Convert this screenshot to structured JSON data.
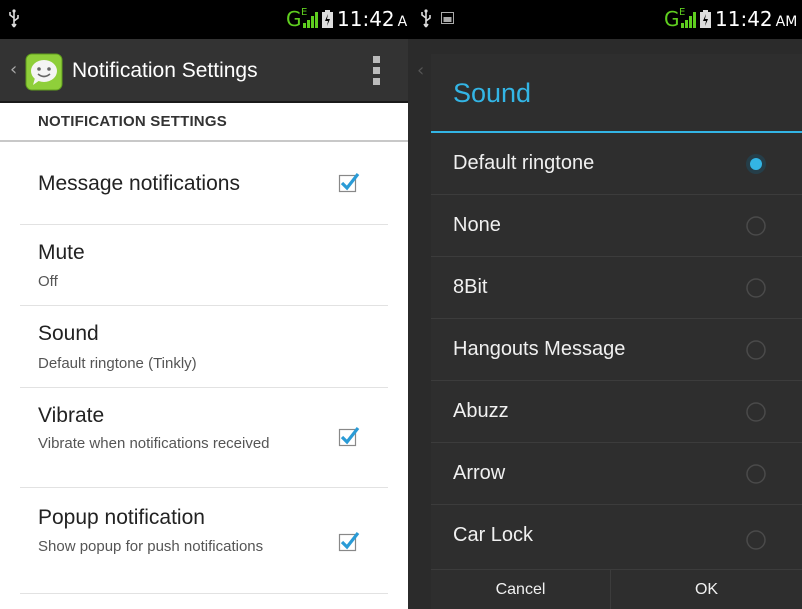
{
  "left": {
    "status": {
      "time": "11:42",
      "ampm": "AM",
      "network": "G",
      "network_sup": "E"
    },
    "actionbar": {
      "title": "Notification Settings"
    },
    "section_header": "NOTIFICATION SETTINGS",
    "prefs": [
      {
        "title": "Message notifications",
        "summary": "",
        "checked": true
      },
      {
        "title": "Mute",
        "summary": "Off"
      },
      {
        "title": "Sound",
        "summary": "Default ringtone (Tinkly)"
      },
      {
        "title": "Vibrate",
        "summary": "Vibrate when notifications received",
        "checked": true
      },
      {
        "title": "Popup notification",
        "summary": "Show popup for push notifications",
        "checked": true
      }
    ]
  },
  "right": {
    "status": {
      "time": "11:42",
      "ampm": "AM",
      "network": "G",
      "network_sup": "E"
    },
    "dialog": {
      "title": "Sound",
      "options": [
        {
          "label": "Default ringtone",
          "selected": true
        },
        {
          "label": "None",
          "selected": false
        },
        {
          "label": "8Bit",
          "selected": false
        },
        {
          "label": "Hangouts Message",
          "selected": false
        },
        {
          "label": "Abuzz",
          "selected": false
        },
        {
          "label": "Arrow",
          "selected": false
        },
        {
          "label": "Car Lock",
          "selected": false
        }
      ],
      "cancel_label": "Cancel",
      "ok_label": "OK"
    }
  },
  "colors": {
    "accent": "#33b5e5",
    "signal": "#5fce1f",
    "actionbar": "#333333",
    "dialog_bg": "#2e2e2e"
  },
  "icons": {
    "usb": "usb-icon",
    "signal": "signal-icon",
    "battery": "battery-icon",
    "app": "messaging-app-icon",
    "overflow": "overflow-menu-icon",
    "checkbox": "checkbox-checked-icon",
    "radio": "radio-icon"
  }
}
